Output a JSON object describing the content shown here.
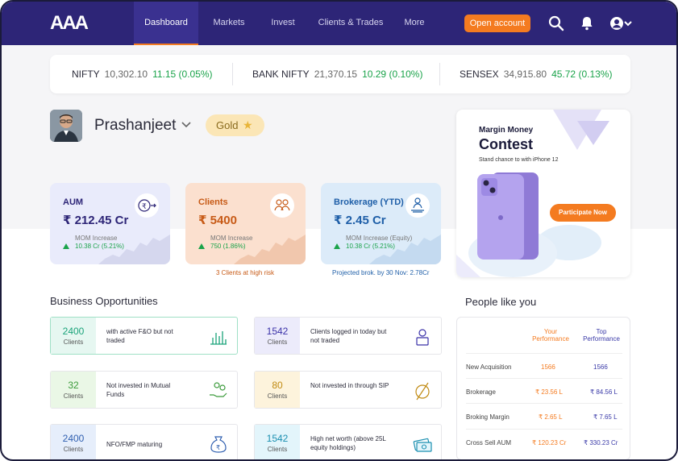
{
  "header": {
    "logo": "AAA",
    "nav": [
      {
        "label": "Dashboard"
      },
      {
        "label": "Markets"
      },
      {
        "label": "Invest"
      },
      {
        "label": "Clients & Trades"
      },
      {
        "label": "More"
      }
    ],
    "open_account": "Open account",
    "icons": [
      "search-icon",
      "bell-icon",
      "user-icon",
      "chevron-down-icon"
    ]
  },
  "ticker": [
    {
      "name": "NIFTY",
      "value": "10,302.10",
      "change": "11.15 (0.05%)"
    },
    {
      "name": "BANK NIFTY",
      "value": "21,370.15",
      "change": "10.29 (0.10%)"
    },
    {
      "name": "SENSEX",
      "value": "34,915.80",
      "change": "45.72 (0.13%)"
    }
  ],
  "profile": {
    "name": "Prashanjeet",
    "tier": "Gold"
  },
  "cards": [
    {
      "title": "AUM",
      "value": "₹ 212.45 Cr",
      "mom_label": "MOM Increase",
      "mom_value": "10.38 Cr (5.21%)",
      "note": "",
      "color": "#e9ebfb",
      "accent": "#2d2577"
    },
    {
      "title": "Clients",
      "value": "₹ 5400",
      "mom_label": "MOM Increase",
      "mom_value": "750 (1.86%)",
      "note": "3 Clients at high risk",
      "color": "#fbe0cf",
      "accent": "#c75a16"
    },
    {
      "title": "Brokerage (YTD)",
      "value": "₹ 2.45 Cr",
      "mom_label": "MOM Increase (Equity)",
      "mom_value": "10.38 Cr (5.21%)",
      "note": "Projected brok. by 30 Nov: 2.78Cr",
      "color": "#dcebf9",
      "accent": "#1f5fa8"
    }
  ],
  "promo": {
    "line1": "Margin Money",
    "line2": "Contest",
    "sub": "Stand chance to with iPhone 12",
    "cta": "Participate Now"
  },
  "business": {
    "title": "Business Opportunities",
    "items": [
      {
        "num": "2400",
        "unit": "Clients",
        "desc": "with active F&O but not traded",
        "icon": "chart-icon",
        "bg": "#e6f7f1",
        "fg": "#1aa37a"
      },
      {
        "num": "1542",
        "unit": "Clients",
        "desc": "Clients logged in today but not traded",
        "icon": "laptop-user-icon",
        "bg": "#ecebfb",
        "fg": "#3a31a8"
      },
      {
        "num": "32",
        "unit": "Clients",
        "desc": "Not invested in Mutual Funds",
        "icon": "coins-hand-icon",
        "bg": "#eaf7e6",
        "fg": "#3a9a3a"
      },
      {
        "num": "80",
        "unit": "Clients",
        "desc": "Not invested in through SIP",
        "icon": "no-sip-icon",
        "bg": "#fdf3dc",
        "fg": "#c08a12"
      },
      {
        "num": "2400",
        "unit": "Clients",
        "desc": "NFO/FMP maturing",
        "icon": "money-bag-icon",
        "bg": "#e6eefb",
        "fg": "#2f5fb0"
      },
      {
        "num": "1542",
        "unit": "Clients",
        "desc": "High net worth (above 25L equity holdings)",
        "icon": "cash-icon",
        "bg": "#e3f5fb",
        "fg": "#1a8fb0"
      }
    ]
  },
  "people": {
    "title": "People like you",
    "col1": "Your Performance",
    "col2": "Top Performance",
    "rows": [
      {
        "label": "New Acquisition",
        "yours": "1566",
        "top": "1566"
      },
      {
        "label": "Brokerage",
        "yours": "₹ 23.56 L",
        "top": "₹ 84.56 L"
      },
      {
        "label": "Broking Margin",
        "yours": "₹ 2.65 L",
        "top": "₹ 7.65 L"
      },
      {
        "label": "Cross Sell AUM",
        "yours": "₹ 120.23 Cr",
        "top": "₹ 330.23 Cr"
      }
    ]
  }
}
